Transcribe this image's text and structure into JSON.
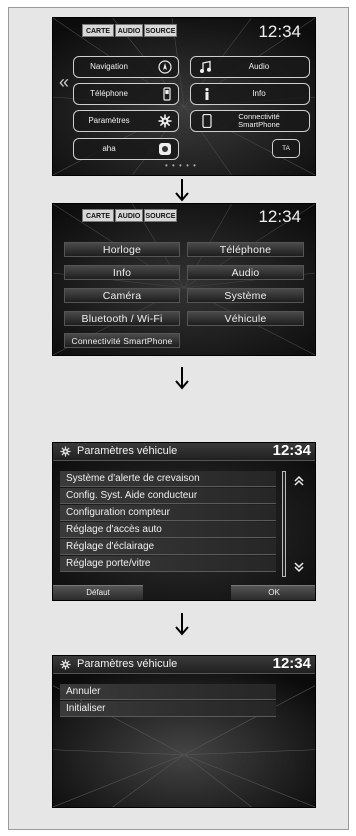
{
  "screen1": {
    "top_tabs": [
      "CARTE",
      "AUDIO",
      "SOURCE"
    ],
    "clock": "12:34",
    "left_buttons": [
      "Navigation",
      "Téléphone",
      "Paramètres",
      "aha"
    ],
    "right_buttons": [
      "Audio",
      "Info",
      "Connectivité SmartPhone",
      "TA"
    ],
    "right_button_line1": "Connectivité",
    "right_button_line2": "SmartPhone",
    "page_dots": "• • • • •",
    "left_arrow": "«"
  },
  "screen2": {
    "top_tabs": [
      "CARTE",
      "AUDIO",
      "SOURCE"
    ],
    "clock": "12:34",
    "left_items": [
      "Horloge",
      "Info",
      "Caméra",
      "Bluetooth / Wi-Fi"
    ],
    "right_items": [
      "Téléphone",
      "Audio",
      "Système",
      "Véhicule"
    ],
    "bottom_item": "Connectivité SmartPhone"
  },
  "screen3": {
    "title": "Paramètres véhicule",
    "clock": "12:34",
    "items": [
      "Système d'alerte de crevaison",
      "Config. Syst. Aide conducteur",
      "Configuration compteur",
      "Réglage d'accès auto",
      "Réglage d'éclairage",
      "Réglage porte/vitre"
    ],
    "scroll_up": "⌃",
    "scroll_down": "⌄",
    "footer_left": "Défaut",
    "footer_right": "OK"
  },
  "screen4": {
    "title": "Paramètres véhicule",
    "clock": "12:34",
    "items": [
      "Annuler",
      "Initialiser"
    ]
  },
  "colors": {
    "screen_bg": "#151515",
    "page_bg": "#e6e6e6",
    "text": "#f0f0f0"
  }
}
